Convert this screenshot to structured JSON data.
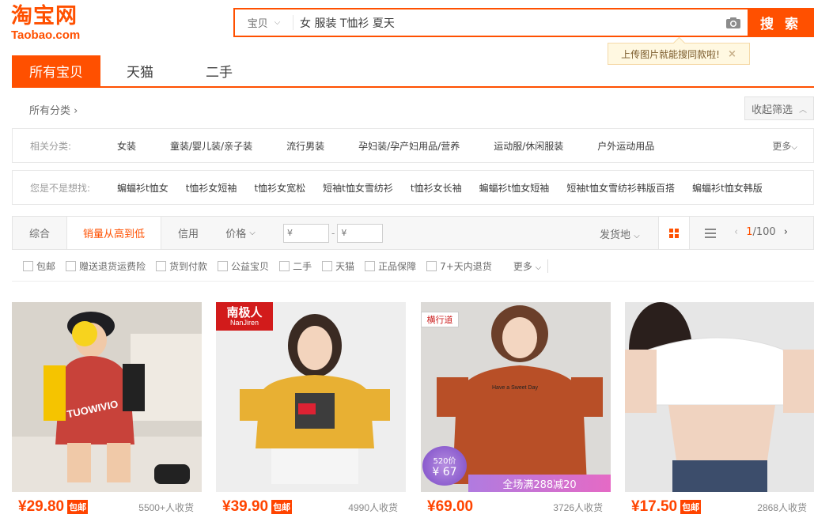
{
  "logo": {
    "cn": "淘宝网",
    "en": "Taobao.com"
  },
  "search": {
    "type_label": "宝贝",
    "query": "女 服装 T恤衫 夏天",
    "button_label": "搜 索",
    "tooltip": "上传图片就能搜同款啦!",
    "tooltip_close": "×"
  },
  "tabs": [
    {
      "label": "所有宝贝",
      "active": true
    },
    {
      "label": "天猫",
      "active": false
    },
    {
      "label": "二手",
      "active": false
    }
  ],
  "categories": {
    "all_label": "所有分类 ›",
    "collapse_label": "收起筛选",
    "related_label": "相关分类:",
    "related": [
      "女装",
      "童装/婴儿装/亲子装",
      "流行男装",
      "孕妇装/孕产妇用品/营养",
      "运动服/休闲服装",
      "户外运动用品"
    ],
    "more_label": "更多",
    "suggest_label": "您是不是想找:",
    "suggest": [
      "蝙蝠衫t恤女",
      "t恤衫女短袖",
      "t恤衫女宽松",
      "短袖t恤女雪纺衫",
      "t恤衫女长袖",
      "蝙蝠衫t恤女短袖",
      "短袖t恤女雪纺衫韩版百搭",
      "蝙蝠衫t恤女韩版"
    ]
  },
  "sort": {
    "comprehensive": "综合",
    "sales": "销量从高到低",
    "credit": "信用",
    "price": "价格",
    "price_min_placeholder": "¥",
    "price_max_placeholder": "¥",
    "ship_from": "发货地",
    "page_current": "1",
    "page_total": "/100"
  },
  "filters": [
    "包邮",
    "赠送退货运费险",
    "货到付款",
    "公益宝贝",
    "二手",
    "天猫",
    "正品保障",
    "7+天内退货"
  ],
  "filters_more": "更多",
  "products": [
    {
      "price": "¥29.80",
      "badge": "包邮",
      "sold": "5500+人收货"
    },
    {
      "price": "¥39.90",
      "badge": "包邮",
      "sold": "4990人收货",
      "brand": "南极人",
      "brand_en": "NanJiren"
    },
    {
      "price": "¥69.00",
      "badge": "",
      "sold": "3726人收货",
      "brand": "横行道",
      "promo": "全场满288减20",
      "coupon_top": "520价",
      "coupon_price": "¥ 67"
    },
    {
      "price": "¥17.50",
      "badge": "包邮",
      "sold": "2868人收货"
    }
  ],
  "colors": {
    "accent": "#ff5000",
    "price": "#ff4400"
  }
}
